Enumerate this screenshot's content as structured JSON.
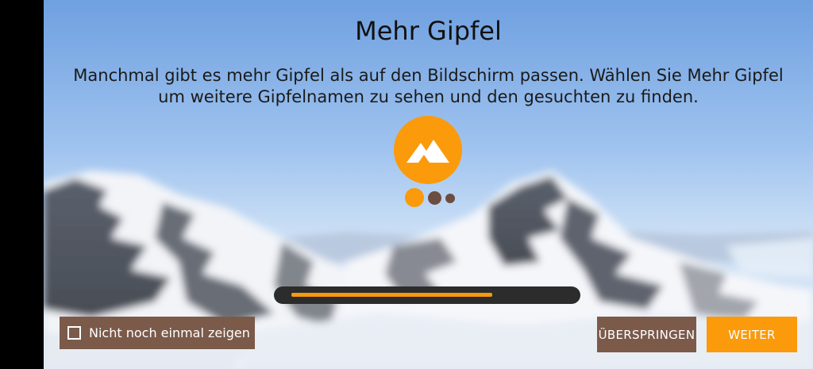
{
  "screen": {
    "title": "Mehr Gipfel",
    "description_line1": "Manchmal gibt es mehr Gipfel als auf den Bildschirm passen. Wählen Sie Mehr Gipfel",
    "description_line2": "um weitere Gipfelnamen zu sehen und den gesuchten zu finden."
  },
  "logo": {
    "icon": "mountain-icon",
    "color": "#fb9a0a"
  },
  "pagination": {
    "pages": 3,
    "active": 1,
    "active_color": "#fb9a0a",
    "inactive_color": "#6b4e3f"
  },
  "progress": {
    "fraction": 0.74,
    "color": "#f59a0c"
  },
  "checkbox": {
    "label": "Nicht noch einmal zeigen",
    "checked": false
  },
  "buttons": {
    "skip_label": "ÜBERSPRINGEN",
    "next_label": "WEITER"
  },
  "colors": {
    "accent": "#fb9a0a",
    "brown": "#7b5a4a"
  }
}
